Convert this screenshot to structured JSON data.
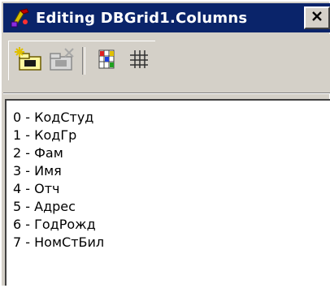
{
  "window": {
    "title": "Editing DBGrid1.Columns"
  },
  "toolbar": {
    "buttons": [
      {
        "icon": "add-new-icon"
      },
      {
        "icon": "delete-icon"
      },
      {
        "icon": "add-all-fields-icon"
      },
      {
        "icon": "restore-defaults-icon"
      }
    ]
  },
  "columns": [
    "0 - КодСтуд",
    "1 - КодГр",
    "2 - Фам",
    "3 - Имя",
    "4 - Отч",
    "5 - Адрес",
    "6 - ГодРожд",
    "7 - НомСтБил"
  ]
}
